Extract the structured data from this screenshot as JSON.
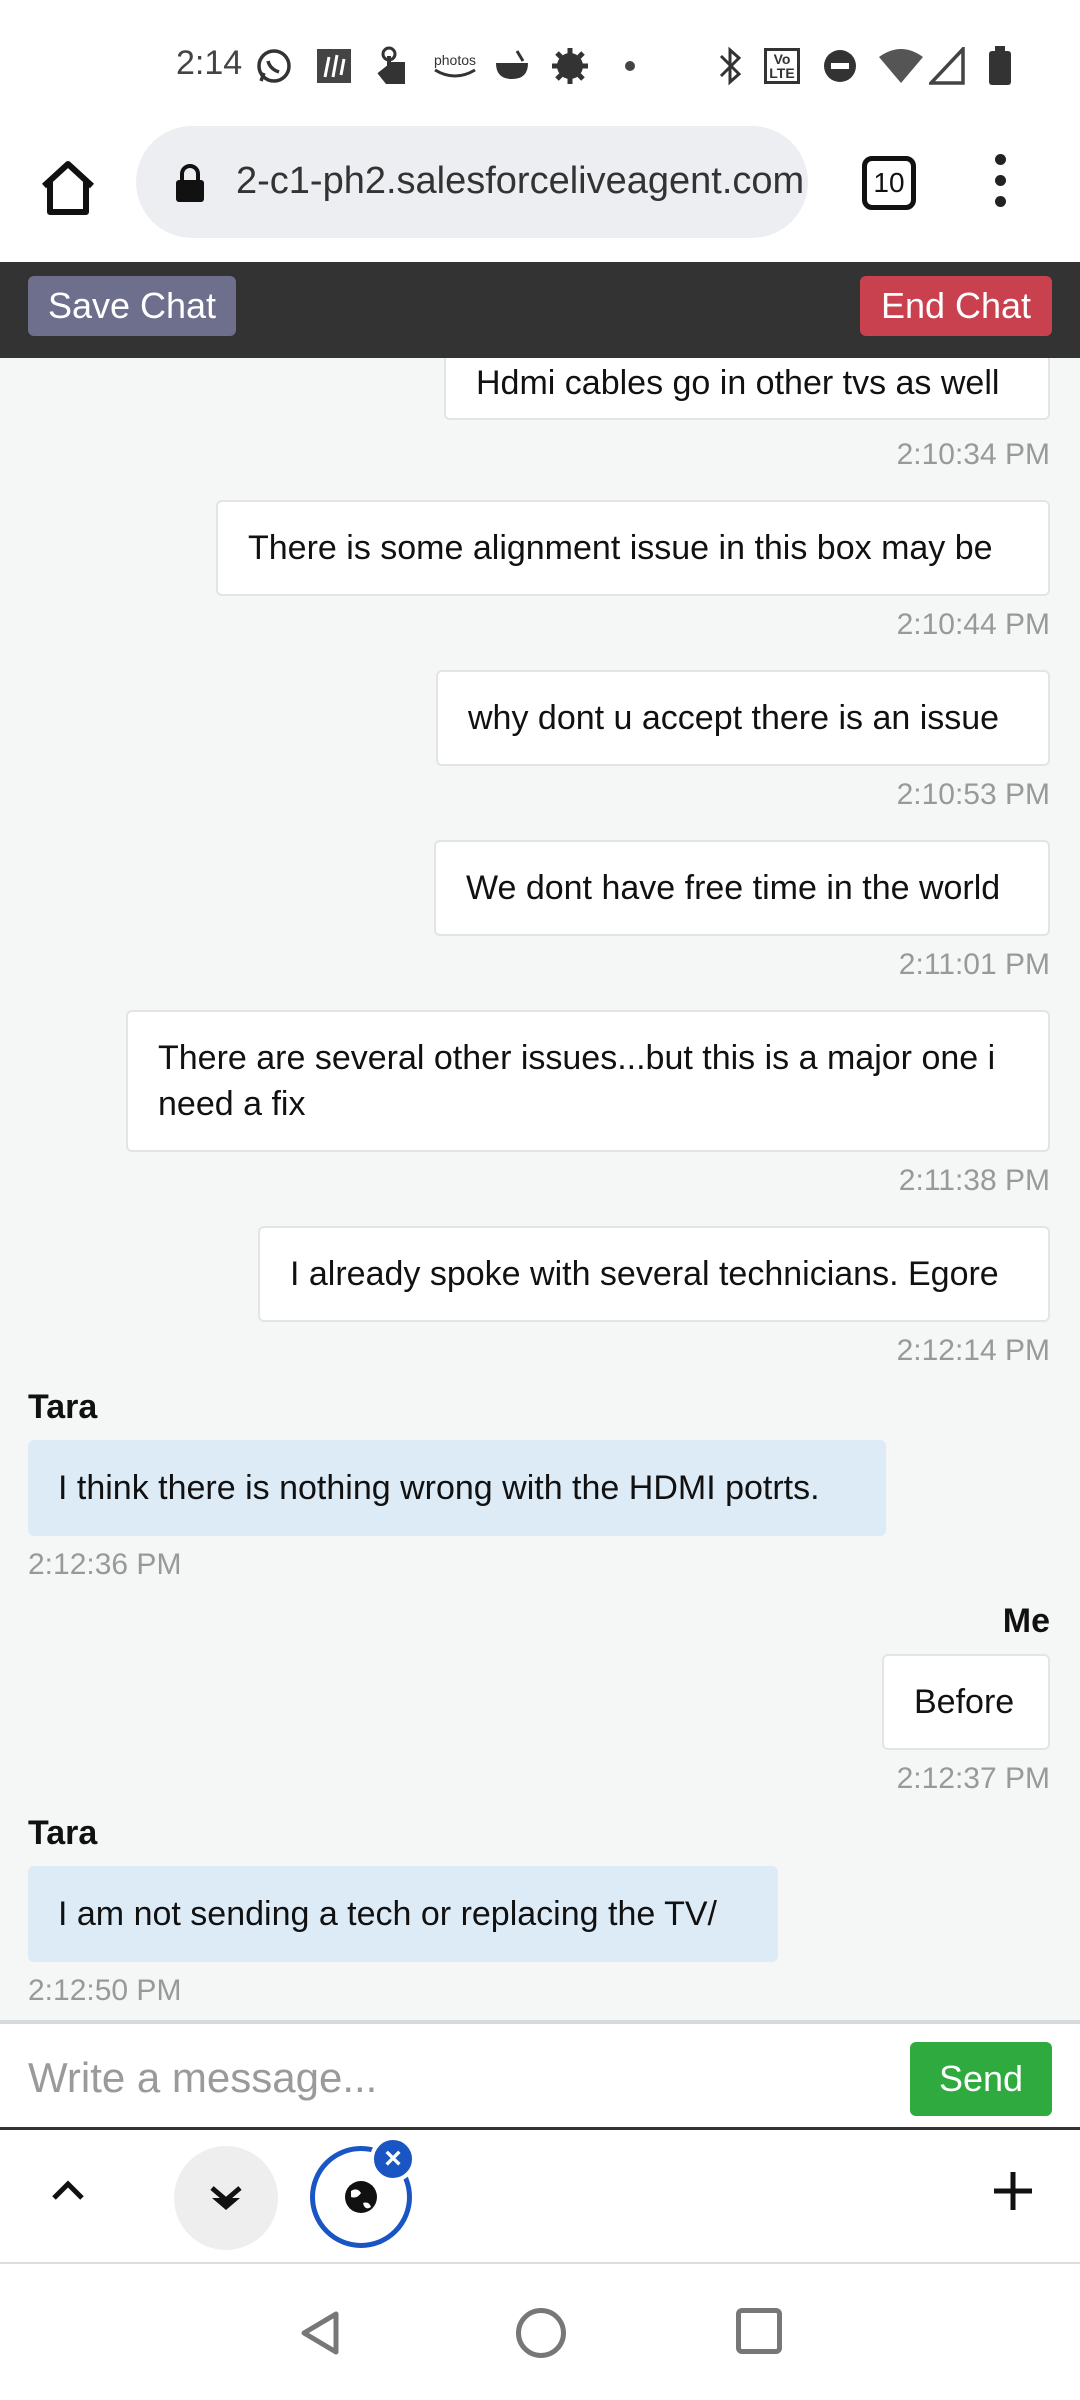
{
  "status_bar": {
    "time": "2:14",
    "icons": [
      "whatsapp-icon",
      "app-icon",
      "touch-icon",
      "photos-icon",
      "bowl-icon",
      "settings-icon",
      "dot-icon",
      "bluetooth-icon",
      "volte-icon",
      "dnd-icon",
      "wifi-icon",
      "signal-icon",
      "battery-icon"
    ],
    "photos_label": "photos",
    "volte_label": "Vo LTE"
  },
  "browser": {
    "url": "2-c1-ph2.salesforceliveagent.com",
    "tab_count": "10"
  },
  "chat_header": {
    "save_label": "Save Chat",
    "end_label": "End Chat",
    "save_color": "#6e6f8c",
    "end_color": "#c9404f"
  },
  "messages": [
    {
      "from": "me",
      "text": "Hdmi cables go in other tvs as well",
      "time": "2:10:34 PM"
    },
    {
      "from": "me",
      "text": "There is some alignment issue in this box may be",
      "time": "2:10:44 PM"
    },
    {
      "from": "me",
      "text": "why dont u accept there is an issue",
      "time": "2:10:53 PM"
    },
    {
      "from": "me",
      "text": "We dont have free time in the world",
      "time": "2:11:01 PM"
    },
    {
      "from": "me",
      "text": "There are several other issues...but this is a major one i need a fix",
      "time": "2:11:38 PM"
    },
    {
      "from": "me",
      "text": "I already spoke with several technicians. Egore",
      "time": "2:12:14 PM"
    },
    {
      "from": "agent",
      "sender": "Tara",
      "text": "I think there is nothing wrong with the HDMI potrts.",
      "time": "2:12:36 PM"
    },
    {
      "from": "me",
      "sender": "Me",
      "text": "Before",
      "time": "2:12:37 PM"
    },
    {
      "from": "agent",
      "sender": "Tara",
      "text": "I am not sending a tech or replacing the TV/",
      "time": "2:12:50 PM"
    }
  ],
  "input": {
    "placeholder": "Write a message...",
    "send_label": "Send",
    "send_color": "#2eaa3f"
  },
  "toolbar": {
    "icons": [
      "chevron-up-icon",
      "download-icon",
      "globe-icon",
      "close-icon",
      "plus-icon"
    ]
  },
  "nav": {
    "icons": [
      "back-icon",
      "home-icon",
      "recents-icon"
    ]
  }
}
